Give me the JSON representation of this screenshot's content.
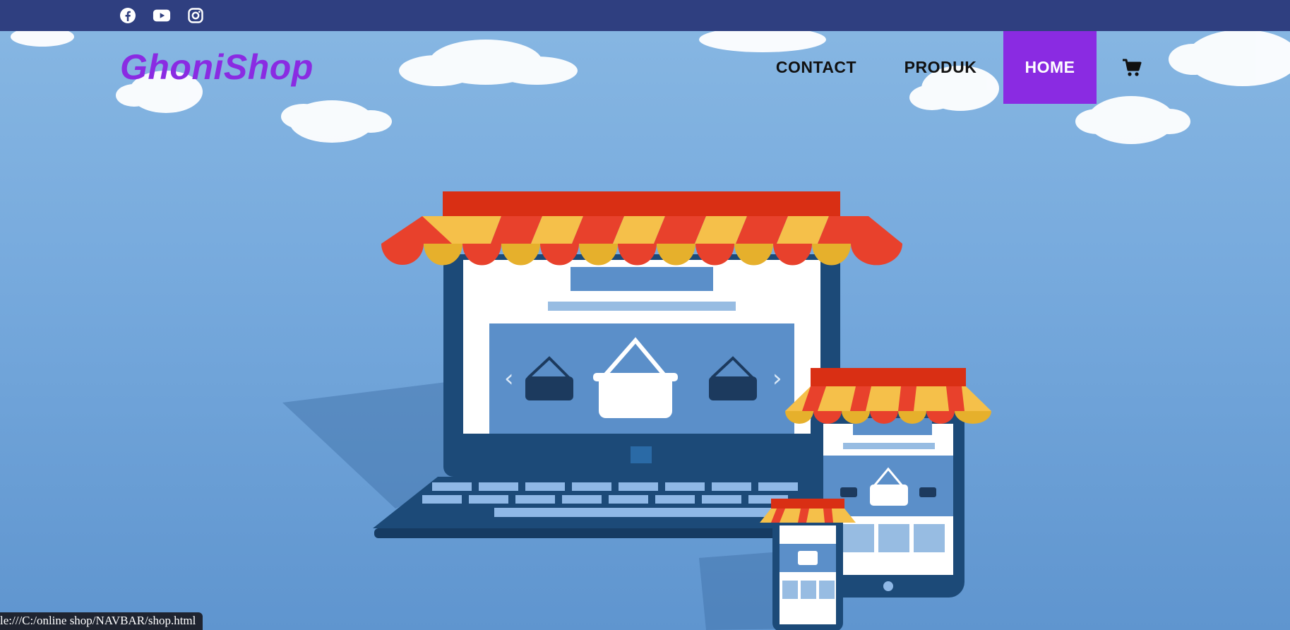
{
  "topbar": {
    "socials": [
      {
        "icon": "facebook-icon"
      },
      {
        "icon": "youtube-icon"
      },
      {
        "icon": "instagram-icon"
      }
    ],
    "background": "#2f3f80"
  },
  "navbar": {
    "brand": "GhoniShop",
    "items": [
      {
        "label": "CONTACT",
        "active": false
      },
      {
        "label": "PRODUK",
        "active": false
      },
      {
        "label": "HOME",
        "active": true
      }
    ],
    "cart_icon": "cart-icon",
    "accent": "#8a2be2"
  },
  "hero": {
    "illustration": "online-shop-devices-illustration",
    "colors": {
      "sky": "#77aadd",
      "awning_red": "#e8412c",
      "awning_yellow": "#f5c04a",
      "device": "#1c4a78"
    }
  },
  "statusbar": {
    "url": "le:///C:/online shop/NAVBAR/shop.html"
  }
}
